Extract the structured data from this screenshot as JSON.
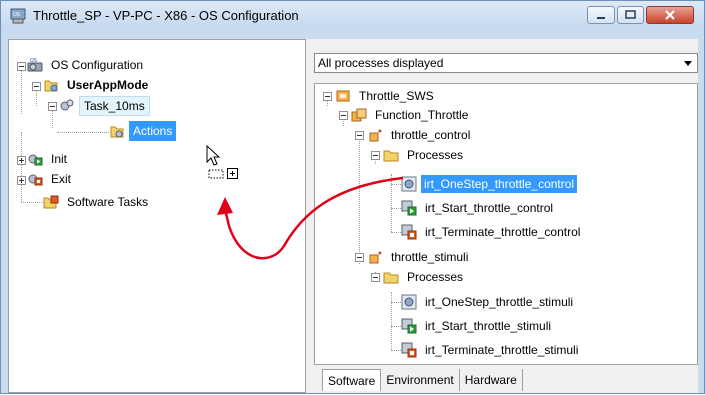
{
  "window": {
    "title": "Throttle_SP - VP-PC - X86 - OS Configuration"
  },
  "left_tree": {
    "root": "OS Configuration",
    "user_app_mode": "UserAppMode",
    "task": "Task_10ms",
    "actions": "Actions",
    "init": "Init",
    "exit": "Exit",
    "software_tasks": "Software Tasks"
  },
  "filter": {
    "selected": "All processes displayed"
  },
  "right_tree": {
    "root": "Throttle_SWS",
    "function": "Function_Throttle",
    "control_module": "throttle_control",
    "control_processes": "Processes",
    "control_items": [
      "irt_OneStep_throttle_control",
      "irt_Start_throttle_control",
      "irt_Terminate_throttle_control"
    ],
    "stimuli_module": "throttle_stimuli",
    "stimuli_processes": "Processes",
    "stimuli_items": [
      "irt_OneStep_throttle_stimuli",
      "irt_Start_throttle_stimuli",
      "irt_Terminate_throttle_stimuli"
    ]
  },
  "tabs": [
    "Software",
    "Environment",
    "Hardware"
  ],
  "colors": {
    "selection": "#3399ff",
    "drag_arrow": "#e0001a"
  },
  "icons": [
    "os-config-icon",
    "user-app-mode-icon",
    "task-icon",
    "actions-icon",
    "init-icon",
    "exit-icon",
    "software-tasks-icon",
    "process-icon",
    "start-icon",
    "terminate-icon",
    "folder-icon",
    "module-icon",
    "function-icon",
    "sws-icon",
    "cursor-icon"
  ]
}
